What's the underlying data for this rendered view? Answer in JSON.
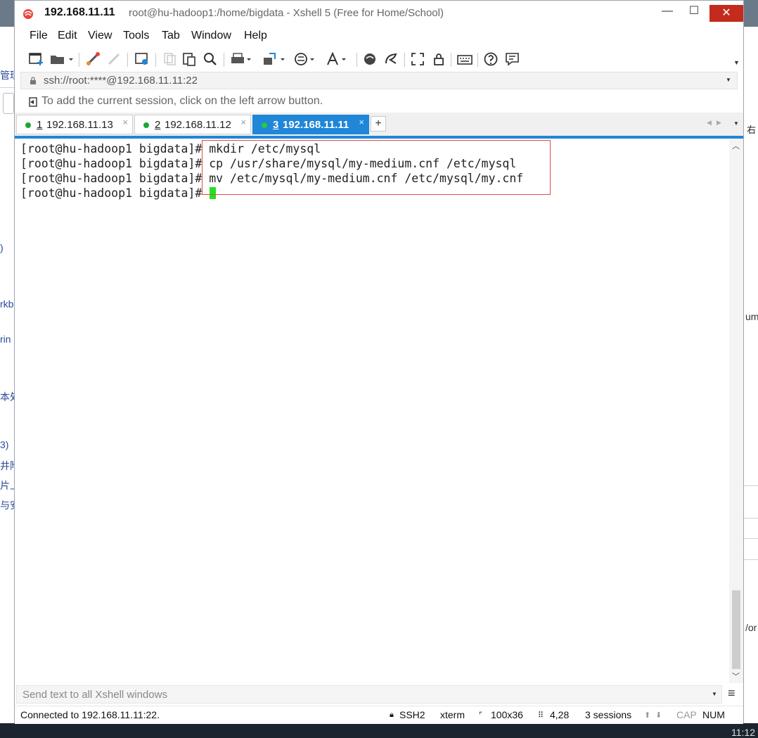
{
  "window": {
    "title_host": "192.168.11.11",
    "title_rest": "root@hu-hadoop1:/home/bigdata - Xshell 5 (Free for Home/School)",
    "minimize": "—",
    "maximize": "☐",
    "close": "✕"
  },
  "menu": [
    "File",
    "Edit",
    "View",
    "Tools",
    "Tab",
    "Window",
    "Help"
  ],
  "address": {
    "value": "ssh://root:****@192.168.11.11:22"
  },
  "hint": "To add the current session, click on the left arrow button.",
  "tabs": [
    {
      "num": "1",
      "label": "192.168.11.13",
      "close": "×",
      "active": false
    },
    {
      "num": "2",
      "label": "192.168.11.12",
      "close": "×",
      "active": false
    },
    {
      "num": "3",
      "label": "192.168.11.11",
      "close": "×",
      "active": true
    }
  ],
  "tab_add": "+",
  "terminal": {
    "lines": [
      "[root@hu-hadoop1 bigdata]# mkdir /etc/mysql",
      "[root@hu-hadoop1 bigdata]# cp /usr/share/mysql/my-medium.cnf /etc/mysql",
      "[root@hu-hadoop1 bigdata]# mv /etc/mysql/my-medium.cnf /etc/mysql/my.cnf",
      "[root@hu-hadoop1 bigdata]# "
    ],
    "cursor_color": "#22e022",
    "highlight_color": "#e24a4a"
  },
  "send_bar": {
    "placeholder": "Send text to all Xshell windows"
  },
  "status": {
    "connected": "Connected to 192.168.11.11:22.",
    "protocol": "SSH2",
    "term_type": "xterm",
    "size": "100x36",
    "cursor_pos": "4,28",
    "sessions": "3 sessions",
    "cap": "CAP",
    "num": "NUM"
  },
  "background": {
    "left_fragments": [
      "管理",
      "ﾞ",
      ")",
      "rkb",
      "rin",
      "本处",
      "3)",
      "井附",
      "片上",
      "与安"
    ],
    "right_fragments": [
      "右",
      "um",
      "/or"
    ],
    "clock": "11:12"
  },
  "colors": {
    "tab_active": "#1f86d8",
    "close_button": "#c42b1c",
    "session_dot": "#1aa832"
  }
}
